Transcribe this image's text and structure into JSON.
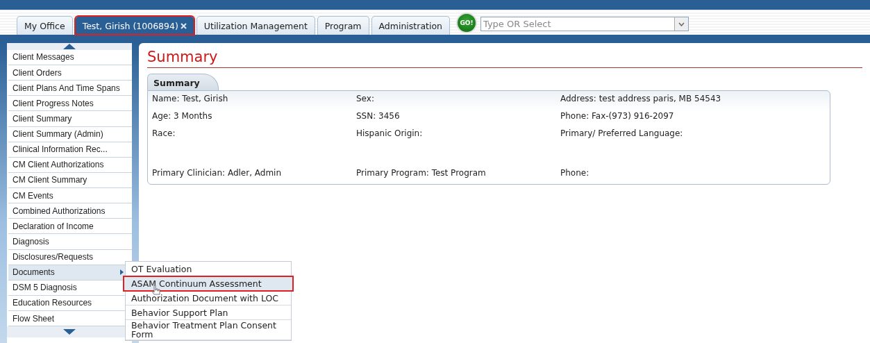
{
  "tabs": [
    {
      "label": "My Office",
      "selected": false,
      "closable": false
    },
    {
      "label": "Test, Girish (1006894)",
      "selected": true,
      "closable": true
    },
    {
      "label": "Utilization Management",
      "selected": false,
      "closable": false
    },
    {
      "label": "Program",
      "selected": false,
      "closable": false
    },
    {
      "label": "Administration",
      "selected": false,
      "closable": false
    }
  ],
  "go_button": "GO!",
  "search": {
    "placeholder": "Type OR Select"
  },
  "sidebar": {
    "items": [
      {
        "label": "Client Messages",
        "selected": false,
        "submenu": false
      },
      {
        "label": "Client Orders",
        "selected": false,
        "submenu": false
      },
      {
        "label": "Client Plans And Time Spans",
        "selected": false,
        "submenu": false
      },
      {
        "label": "Client Progress Notes",
        "selected": false,
        "submenu": false
      },
      {
        "label": "Client Summary",
        "selected": false,
        "submenu": false
      },
      {
        "label": "Client Summary (Admin)",
        "selected": false,
        "submenu": false
      },
      {
        "label": "Clinical Information Rec...",
        "selected": false,
        "submenu": false
      },
      {
        "label": "CM Client Authorizations",
        "selected": false,
        "submenu": false
      },
      {
        "label": "CM Client Summary",
        "selected": false,
        "submenu": false
      },
      {
        "label": "CM Events",
        "selected": false,
        "submenu": false
      },
      {
        "label": "Combined Authorizations",
        "selected": false,
        "submenu": false
      },
      {
        "label": "Declaration of Income",
        "selected": false,
        "submenu": false
      },
      {
        "label": "Diagnosis",
        "selected": false,
        "submenu": false
      },
      {
        "label": "Disclosures/Requests",
        "selected": false,
        "submenu": false
      },
      {
        "label": "Documents",
        "selected": true,
        "submenu": true
      },
      {
        "label": "DSM 5 Diagnosis",
        "selected": false,
        "submenu": false
      },
      {
        "label": "Education Resources",
        "selected": false,
        "submenu": false
      },
      {
        "label": "Flow Sheet",
        "selected": false,
        "submenu": false
      }
    ]
  },
  "submenu": {
    "items": [
      {
        "label": "OT Evaluation",
        "selected": false
      },
      {
        "label": "ASAM Continuum Assessment",
        "selected": true
      },
      {
        "label": "Authorization Document with LOC",
        "selected": false
      },
      {
        "label": "Behavior Support Plan",
        "selected": false
      },
      {
        "label": "Behavior Treatment Plan Consent Form",
        "selected": false
      }
    ]
  },
  "page_title": "Summary",
  "summary": {
    "tab": "Summary",
    "rows": [
      [
        {
          "label": "Name:",
          "value": "Test, Girish"
        },
        {
          "label": "Sex:"
        },
        {
          "label": "Address:",
          "value": "test address paris, MB 54543"
        }
      ],
      [
        {
          "label": "Age:",
          "value": "3 Months"
        },
        {
          "label": "SSN:",
          "value": "3456"
        },
        {
          "label": "Phone:",
          "value": "Fax-(973) 916-2097"
        }
      ],
      [
        {
          "label": "Race:"
        },
        {
          "label": "Hispanic Origin:"
        },
        {
          "label": "Primary/ Preferred Language:"
        }
      ],
      [
        {
          "label": "Primary Clinician:",
          "value": "Adler, Admin"
        },
        {
          "label": "Primary Program:",
          "value": "Test Program"
        },
        {
          "label": "Phone:"
        }
      ]
    ]
  }
}
